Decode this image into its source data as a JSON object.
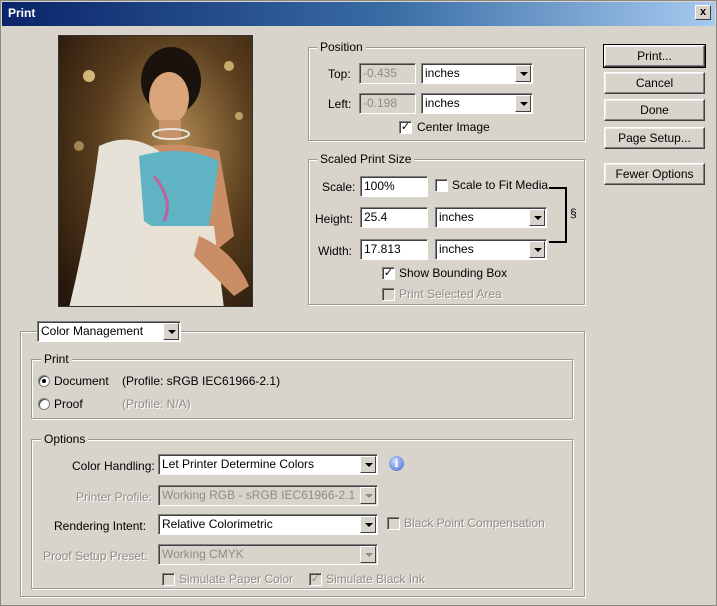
{
  "window": {
    "title": "Print",
    "close_glyph": "x"
  },
  "buttons": {
    "print": "Print...",
    "cancel": "Cancel",
    "done": "Done",
    "page_setup": "Page Setup...",
    "fewer_options": "Fewer Options"
  },
  "position": {
    "legend": "Position",
    "top_label": "Top:",
    "top_value": "-0.435",
    "top_units": "inches",
    "left_label": "Left:",
    "left_value": "-0.198",
    "left_units": "inches",
    "center_image_label": "Center Image",
    "center_image_checked": true
  },
  "scaled": {
    "legend": "Scaled Print Size",
    "scale_label": "Scale:",
    "scale_value": "100%",
    "scale_to_fit_label": "Scale to Fit Media",
    "scale_to_fit_checked": false,
    "height_label": "Height:",
    "height_value": "25.4",
    "height_units": "inches",
    "width_label": "Width:",
    "width_value": "17.813",
    "width_units": "inches",
    "show_bounding_label": "Show Bounding Box",
    "show_bounding_checked": true,
    "print_selected_label": "Print Selected Area",
    "print_selected_checked": false,
    "link_icon": "chain-link-icon"
  },
  "section_select": "Color Management",
  "print_group": {
    "legend": "Print",
    "document_label": "Document",
    "document_profile": "(Profile: sRGB IEC61966-2.1)",
    "proof_label": "Proof",
    "proof_profile": "(Profile: N/A)",
    "selected": "document"
  },
  "options": {
    "legend": "Options",
    "color_handling_label": "Color Handling:",
    "color_handling_value": "Let Printer Determine Colors",
    "printer_profile_label": "Printer Profile:",
    "printer_profile_value": "Working RGB - sRGB IEC61966-2.1",
    "rendering_intent_label": "Rendering Intent:",
    "rendering_intent_value": "Relative Colorimetric",
    "black_point_label": "Black Point Compensation",
    "proof_setup_label": "Proof Setup Preset:",
    "proof_setup_value": "Working CMYK",
    "simulate_paper_label": "Simulate Paper Color",
    "simulate_black_label": "Simulate Black Ink",
    "simulate_black_checked": true
  }
}
